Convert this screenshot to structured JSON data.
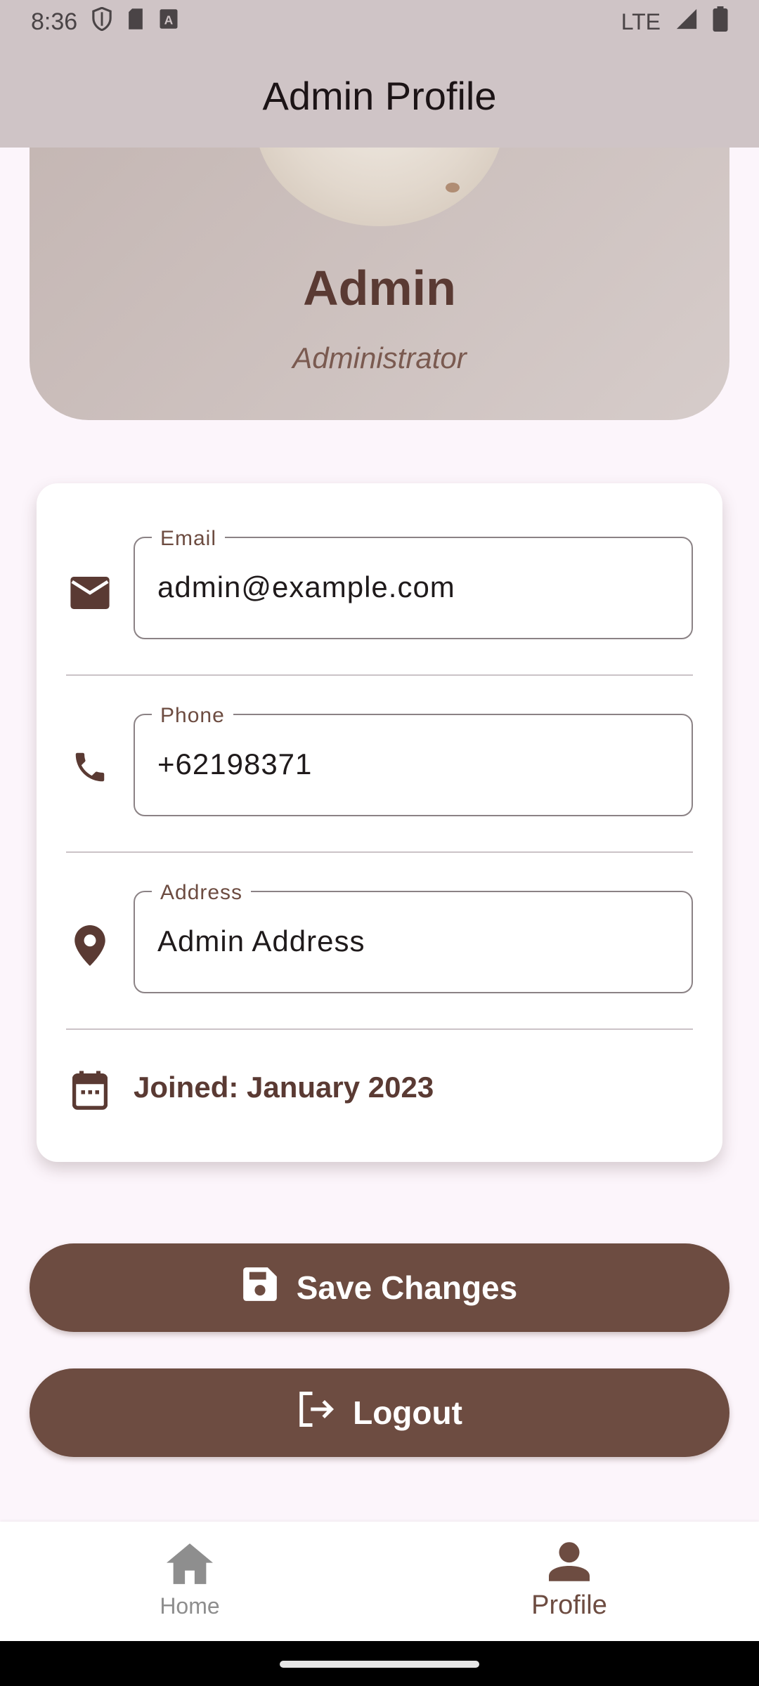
{
  "status_bar": {
    "time": "8:36",
    "network": "LTE",
    "icons": [
      "shield-icon",
      "sd-card-icon",
      "font-icon",
      "signal-icon",
      "battery-icon"
    ]
  },
  "app_bar": {
    "title": "Admin Profile"
  },
  "profile": {
    "name": "Admin",
    "role": "Administrator"
  },
  "fields": {
    "email": {
      "label": "Email",
      "value": "admin@example.com",
      "icon": "mail-icon"
    },
    "phone": {
      "label": "Phone",
      "value": "+62198371",
      "icon": "phone-icon"
    },
    "address": {
      "label": "Address",
      "value": "Admin Address",
      "icon": "location-pin-icon"
    }
  },
  "joined": {
    "text": "Joined: January 2023",
    "icon": "calendar-icon"
  },
  "buttons": {
    "save_label": "Save Changes",
    "logout_label": "Logout"
  },
  "bottom_nav": {
    "items": [
      {
        "label": "Home",
        "icon": "home-icon",
        "active": false
      },
      {
        "label": "Profile",
        "icon": "person-icon",
        "active": true
      }
    ]
  },
  "colors": {
    "primary": "#6d4c41",
    "app_bar": "#cfc4c6",
    "background": "#fcf5fb",
    "header_gradient_start": "#c4b6b3",
    "header_gradient_end": "#d6ccca"
  }
}
